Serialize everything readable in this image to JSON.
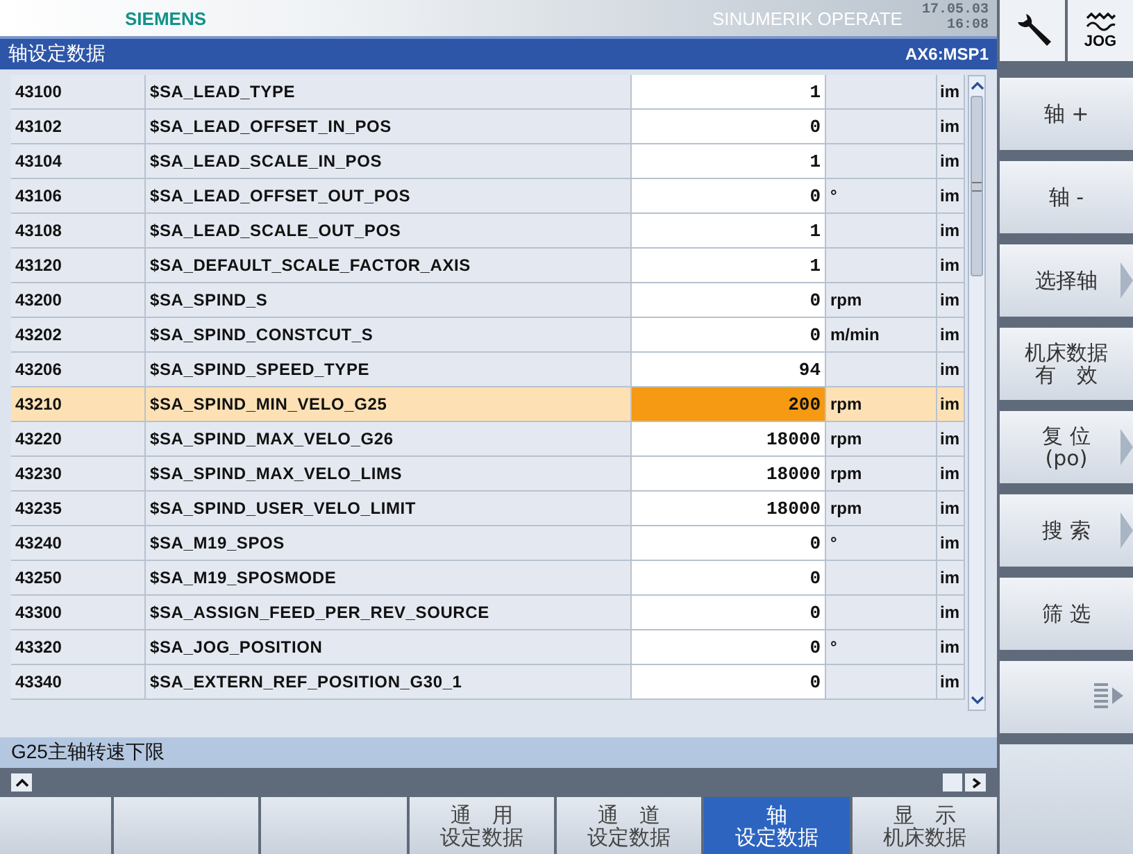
{
  "header": {
    "brand": "SIEMENS",
    "product": "SINUMERIK OPERATE",
    "date": "17.05.03",
    "time": "16:08",
    "mode": "JOG"
  },
  "title": "轴设定数据",
  "axis": "AX6:MSP1",
  "rows": [
    {
      "id": "43100",
      "name": "$SA_LEAD_TYPE",
      "value": "1",
      "unit": "",
      "flag": "im",
      "selected": false
    },
    {
      "id": "43102",
      "name": "$SA_LEAD_OFFSET_IN_POS",
      "value": "0",
      "unit": "",
      "flag": "im",
      "selected": false
    },
    {
      "id": "43104",
      "name": "$SA_LEAD_SCALE_IN_POS",
      "value": "1",
      "unit": "",
      "flag": "im",
      "selected": false
    },
    {
      "id": "43106",
      "name": "$SA_LEAD_OFFSET_OUT_POS",
      "value": "0",
      "unit": "°",
      "flag": "im",
      "selected": false
    },
    {
      "id": "43108",
      "name": "$SA_LEAD_SCALE_OUT_POS",
      "value": "1",
      "unit": "",
      "flag": "im",
      "selected": false
    },
    {
      "id": "43120",
      "name": "$SA_DEFAULT_SCALE_FACTOR_AXIS",
      "value": "1",
      "unit": "",
      "flag": "im",
      "selected": false
    },
    {
      "id": "43200",
      "name": "$SA_SPIND_S",
      "value": "0",
      "unit": "rpm",
      "flag": "im",
      "selected": false
    },
    {
      "id": "43202",
      "name": "$SA_SPIND_CONSTCUT_S",
      "value": "0",
      "unit": "m/min",
      "flag": "im",
      "selected": false
    },
    {
      "id": "43206",
      "name": "$SA_SPIND_SPEED_TYPE",
      "value": "94",
      "unit": "",
      "flag": "im",
      "selected": false
    },
    {
      "id": "43210",
      "name": "$SA_SPIND_MIN_VELO_G25",
      "value": "200",
      "unit": "rpm",
      "flag": "im",
      "selected": true
    },
    {
      "id": "43220",
      "name": "$SA_SPIND_MAX_VELO_G26",
      "value": "18000",
      "unit": "rpm",
      "flag": "im",
      "selected": false
    },
    {
      "id": "43230",
      "name": "$SA_SPIND_MAX_VELO_LIMS",
      "value": "18000",
      "unit": "rpm",
      "flag": "im",
      "selected": false
    },
    {
      "id": "43235",
      "name": "$SA_SPIND_USER_VELO_LIMIT",
      "value": "18000",
      "unit": "rpm",
      "flag": "im",
      "selected": false
    },
    {
      "id": "43240",
      "name": "$SA_M19_SPOS",
      "value": "0",
      "unit": "°",
      "flag": "im",
      "selected": false
    },
    {
      "id": "43250",
      "name": "$SA_M19_SPOSMODE",
      "value": "0",
      "unit": "",
      "flag": "im",
      "selected": false
    },
    {
      "id": "43300",
      "name": "$SA_ASSIGN_FEED_PER_REV_SOURCE",
      "value": "0",
      "unit": "",
      "flag": "im",
      "selected": false
    },
    {
      "id": "43320",
      "name": "$SA_JOG_POSITION",
      "value": "0",
      "unit": "°",
      "flag": "im",
      "selected": false
    },
    {
      "id": "43340",
      "name": "$SA_EXTERN_REF_POSITION_G30_1",
      "value": "0",
      "unit": "",
      "flag": "im",
      "selected": false
    }
  ],
  "description": "G25主轴转速下限",
  "right_softkeys": [
    {
      "kind": "text",
      "lines": [
        "轴 +"
      ],
      "arrow": false
    },
    {
      "kind": "text",
      "lines": [
        "轴 -"
      ],
      "arrow": false
    },
    {
      "kind": "text",
      "lines": [
        "选择轴"
      ],
      "arrow": true
    },
    {
      "kind": "text",
      "lines": [
        "机床数据",
        "有　效"
      ],
      "arrow": false
    },
    {
      "kind": "text",
      "lines": [
        "复 位",
        "(po)"
      ],
      "arrow": true
    },
    {
      "kind": "text",
      "lines": [
        "搜 索"
      ],
      "arrow": true
    },
    {
      "kind": "text",
      "lines": [
        "筛 选"
      ],
      "arrow": false
    },
    {
      "kind": "more"
    }
  ],
  "bottom_softkeys": [
    {
      "lines": [
        "通　用",
        "设定数据"
      ],
      "selected": false
    },
    {
      "lines": [
        "通　道",
        "设定数据"
      ],
      "selected": false
    },
    {
      "lines": [
        "轴",
        "设定数据"
      ],
      "selected": true
    },
    {
      "lines": [
        "显　示",
        "机床数据"
      ],
      "selected": false
    }
  ]
}
